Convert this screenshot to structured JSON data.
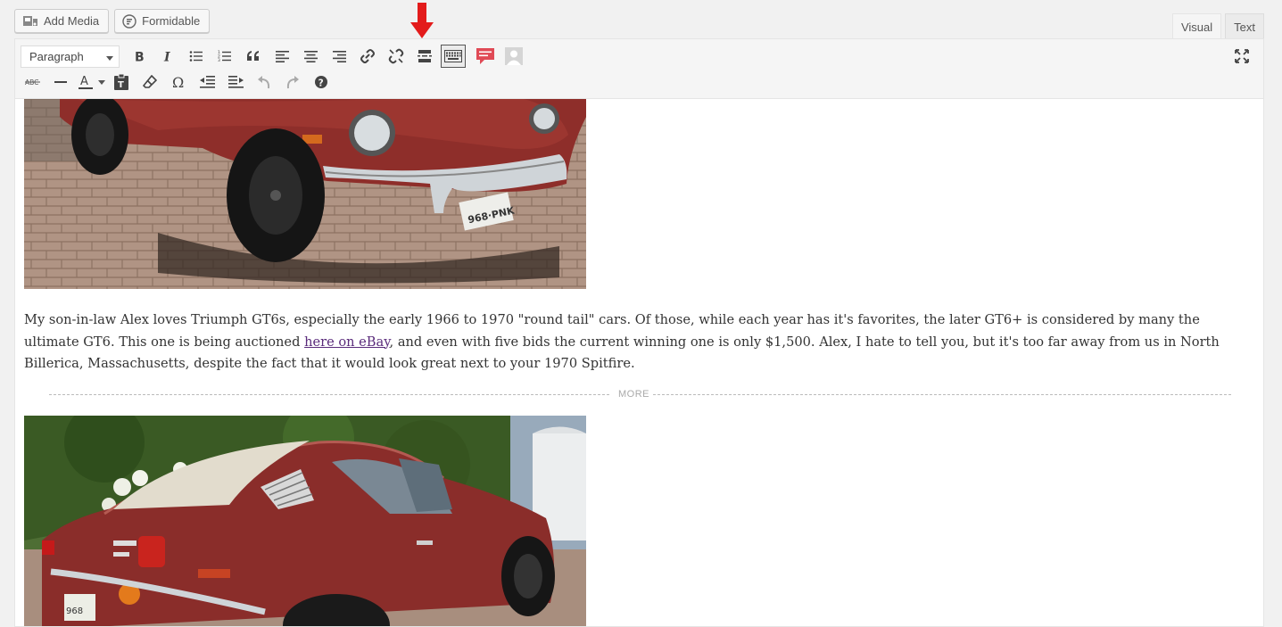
{
  "media_buttons": {
    "add_media": "Add Media",
    "formidable": "Formidable"
  },
  "tabs": {
    "visual": "Visual",
    "text": "Text",
    "active": "visual"
  },
  "toolbar": {
    "format_select": "Paragraph",
    "row1_icons": [
      "bold-icon",
      "italic-icon",
      "bullet-list-icon",
      "numbered-list-icon",
      "blockquote-icon",
      "align-left-icon",
      "align-center-icon",
      "align-right-icon",
      "link-icon",
      "unlink-icon",
      "read-more-icon",
      "toolbar-toggle-icon",
      "comment-icon",
      "avatar-icon"
    ],
    "row2_icons": [
      "strikethrough-icon",
      "horizontal-line-icon",
      "text-color-icon",
      "paste-text-icon",
      "clear-formatting-icon",
      "special-character-icon",
      "outdent-icon",
      "indent-icon",
      "undo-icon",
      "redo-icon",
      "help-icon"
    ],
    "strike_label": "ABC",
    "text_color_label": "A"
  },
  "content": {
    "paragraph_before": "My son-in-law Alex loves Triumph GT6s, especially the early 1966 to 1970 \"round tail\" cars. Of those, while each year has it's favorites, the later GT6+ is considered by many the ultimate GT6. This one is being auctioned ",
    "link_text": "here on eBay",
    "paragraph_after": ", and even with five bids the current winning one is only $1,500. Alex, I hate to tell you, but it's too far away from us in North Billerica, Massachusetts, despite the fact that it would look great next to your 1970 Spitfire.",
    "more_label": "MORE"
  },
  "colors": {
    "annotation_arrow": "#e31b1b",
    "link": "#5a2b7b",
    "car_red": "#8e2e2a"
  }
}
